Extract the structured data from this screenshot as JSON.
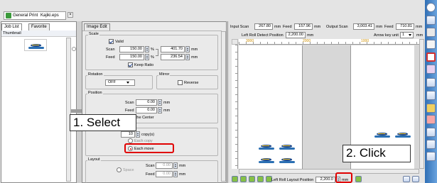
{
  "window_tab": {
    "label": "General Print",
    "file": "Kajiki.eps"
  },
  "left_tabs": {
    "job_list": "Job List",
    "favorite": "Favorite"
  },
  "thumbnail_label": "Thumbnail",
  "image_edit_tab": "Image Edit",
  "scale": {
    "group_label": "Scale",
    "valid_label": "Valid",
    "scan_label": "Scan",
    "scan_value": "150.00",
    "scan_pct": "%",
    "scan_mm_value": "401.70",
    "feed_label": "Feed",
    "feed_value": "150.00",
    "feed_pct": "%",
    "feed_mm_value": "236.54",
    "mm_unit": "mm",
    "keep_ratio_label": "Keep Ratio"
  },
  "rotation": {
    "group_label": "Rotation",
    "value": "OFF"
  },
  "mirror": {
    "group_label": "Mirror",
    "reverse_label": "Reverse"
  },
  "position": {
    "group_label": "Position",
    "scan_label": "Scan",
    "scan_value": "0.00",
    "feed_label": "Feed",
    "feed_value": "0.00",
    "arrange_label": "Arrange in the Center",
    "mm_unit": "mm"
  },
  "copies": {
    "value": "10",
    "unit_label": "copy(s)"
  },
  "layout_mode": {
    "option1": "Each copy",
    "option2": "Each move"
  },
  "layout": {
    "group_label": "Layout",
    "scan_label": "Scan",
    "scan_value": "0.00",
    "space_label": "Space",
    "feed_label": "Feed",
    "feed_value": "0.00",
    "mm_unit": "mm"
  },
  "top_info": {
    "input_scan_label": "Input Scan",
    "input_scan_value": "267.80",
    "mm1": "mm",
    "feed_label": "Feed",
    "feed_value": "157.96",
    "mm2": "mm",
    "output_scan_label": "Output Scan",
    "output_scan_value": "3,003.41",
    "mm3": "mm",
    "output_feed_label": "Feed",
    "output_feed_value": "710.81",
    "mm4": "mm"
  },
  "detect": {
    "label": "Left Roll Detect Position",
    "value": "2,200.00",
    "unit": "mm",
    "arrow_key_label": "Arrow key unit",
    "arrow_key_value": "1",
    "arrow_key_unit": "mm"
  },
  "ruler": {
    "t1": "3000",
    "t2": "2000",
    "t3": "1000"
  },
  "bottom": {
    "layout_pos_label": "Left Roll Layout Position",
    "layout_pos_value": "2,200.0",
    "unit": "mm"
  },
  "callouts": {
    "select": "1. Select",
    "click": "2. Click"
  }
}
